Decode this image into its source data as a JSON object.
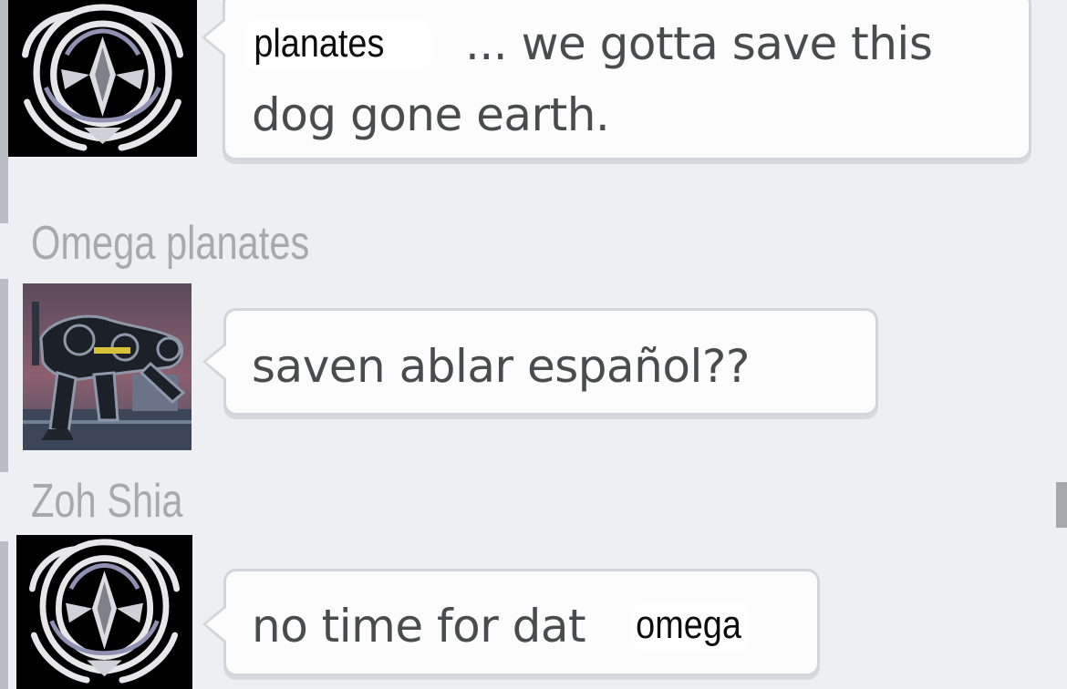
{
  "messages": [
    {
      "sender": "",
      "text_line1": "... we gotta save this",
      "text_line2": "dog gone earth.",
      "overlay": "planates"
    },
    {
      "sender": "Omega planates",
      "text": "saven ablar español??"
    },
    {
      "sender": "Zoh Shia",
      "text": "no time for dat",
      "overlay": "omega"
    }
  ],
  "colors": {
    "background": "#eeeff3",
    "bubble": "#fcfcfd",
    "bubble_border": "#d3d5da",
    "message_text": "#4a4b4f",
    "username_text": "#a7a9ad"
  },
  "icons": {
    "avatar_1": "tribal-emblem-avatar",
    "avatar_2": "mech-robot-avatar",
    "avatar_3": "tribal-emblem-avatar"
  }
}
